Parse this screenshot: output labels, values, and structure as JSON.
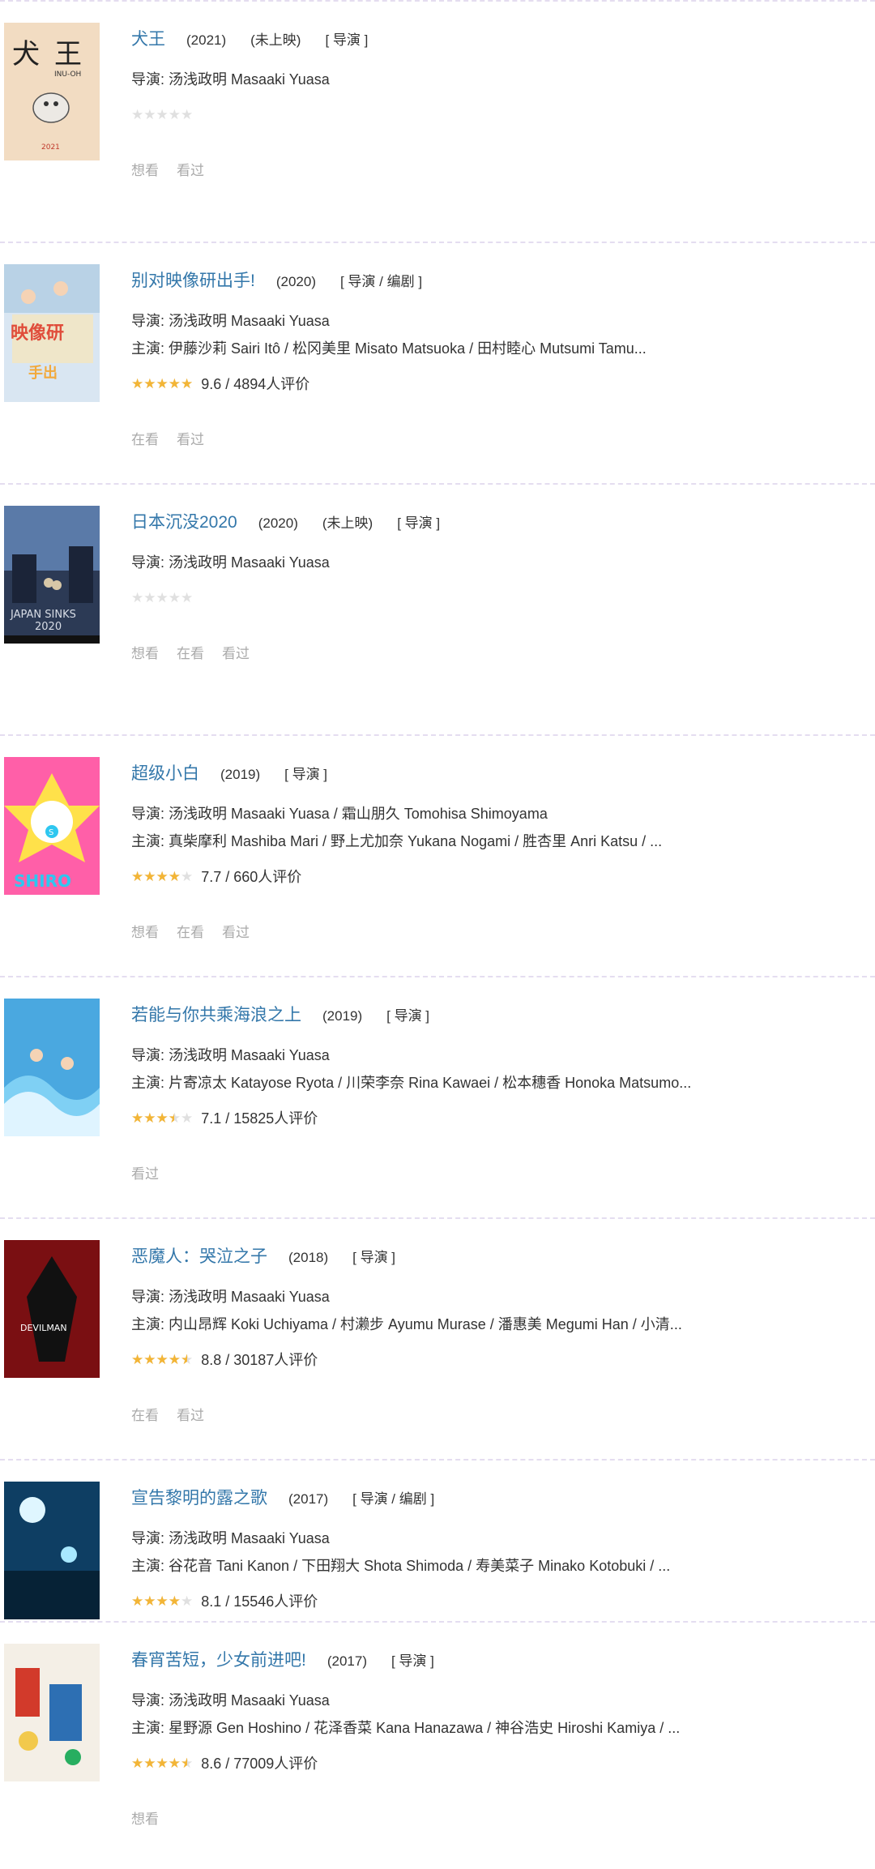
{
  "items": [
    {
      "title": "犬王",
      "meta": [
        "(2021)",
        "(未上映)",
        "[ 导演 ]"
      ],
      "director": "导演: 汤浅政明 Masaaki Yuasa",
      "cast": "",
      "stars": 0,
      "rating": "",
      "actions": [
        "想看",
        "看过"
      ],
      "poster": {
        "bg": "#f2dcc2",
        "accent": "#222",
        "label": "INU-OH"
      }
    },
    {
      "title": "别对映像研出手!",
      "meta": [
        "(2020)",
        "[ 导演 / 编剧 ]"
      ],
      "director": "导演: 汤浅政明 Masaaki Yuasa",
      "cast": "主演: 伊藤沙莉 Sairi Itô / 松冈美里 Misato Matsuoka / 田村睦心 Mutsumi Tamu...",
      "stars": 5,
      "rating": "9.6 / 4894人评价",
      "actions": [
        "在看",
        "看过"
      ],
      "poster": {
        "bg": "#d9e6f2",
        "accent": "#e04d3b",
        "label": ""
      }
    },
    {
      "title": "日本沉没2020",
      "meta": [
        "(2020)",
        "(未上映)",
        "[ 导演 ]"
      ],
      "director": "导演: 汤浅政明 Masaaki Yuasa",
      "cast": "",
      "stars": 0,
      "rating": "",
      "actions": [
        "想看",
        "在看",
        "看过"
      ],
      "poster": {
        "bg": "#2c3a55",
        "accent": "#d8dde6",
        "label": "JAPAN SINKS"
      }
    },
    {
      "title": "超级小白",
      "meta": [
        "(2019)",
        "[ 导演 ]"
      ],
      "director": "导演: 汤浅政明 Masaaki Yuasa / 霜山朋久 Tomohisa Shimoyama",
      "cast": "主演: 真柴摩利 Mashiba Mari / 野上尤加奈 Yukana Nogami / 胜杏里 Anri Katsu / ...",
      "stars": 4,
      "rating": "7.7 / 660人评价",
      "actions": [
        "想看",
        "在看",
        "看过"
      ],
      "poster": {
        "bg": "#ff5fa8",
        "accent": "#2ec7f0",
        "label": "SHIRO"
      }
    },
    {
      "title": "若能与你共乘海浪之上",
      "meta": [
        "(2019)",
        "[ 导演 ]"
      ],
      "director": "导演: 汤浅政明 Masaaki Yuasa",
      "cast": "主演: 片寄凉太 Katayose Ryota / 川荣李奈 Rina Kawaei / 松本穗香 Honoka Matsumo...",
      "stars": 3.5,
      "rating": "7.1 / 15825人评价",
      "actions": [
        "看过"
      ],
      "poster": {
        "bg": "#4aa8e0",
        "accent": "#ffffff",
        "label": ""
      }
    },
    {
      "title": "恶魔人：哭泣之子",
      "meta": [
        "(2018)",
        "[ 导演 ]"
      ],
      "director": "导演: 汤浅政明 Masaaki Yuasa",
      "cast": "主演: 内山昂辉 Koki Uchiyama / 村濑步 Ayumu Murase / 潘惠美 Megumi Han / 小清...",
      "stars": 4.5,
      "rating": "8.8 / 30187人评价",
      "actions": [
        "在看",
        "看过"
      ],
      "poster": {
        "bg": "#7a0f12",
        "accent": "#111111",
        "label": "DEVILMAN"
      }
    },
    {
      "title": "宣告黎明的露之歌",
      "meta": [
        "(2017)",
        "[ 导演 / 编剧 ]"
      ],
      "director": "导演: 汤浅政明 Masaaki Yuasa",
      "cast": "主演: 谷花音 Tani Kanon / 下田翔大 Shota Shimoda / 寿美菜子 Minako Kotobuki / ...",
      "stars": 4,
      "rating": "8.1 / 15546人评价",
      "actions": [],
      "poster": {
        "bg": "#0e3e63",
        "accent": "#a8e8ff",
        "label": ""
      }
    },
    {
      "title": "春宵苦短，少女前进吧!",
      "meta": [
        "(2017)",
        "[ 导演 ]"
      ],
      "director": "导演: 汤浅政明 Masaaki Yuasa",
      "cast": "主演: 星野源 Gen Hoshino / 花泽香菜 Kana Hanazawa / 神谷浩史 Hiroshi Kamiya / ...",
      "stars": 4.5,
      "rating": "8.6 / 77009人评价",
      "actions": [
        "想看"
      ],
      "poster": {
        "bg": "#f4efe6",
        "accent": "#d23a2b",
        "label": ""
      }
    }
  ],
  "icons": {
    "star": "star-icon"
  },
  "colors": {
    "title": "#3377aa",
    "star": "#f3b536",
    "star_empty": "#e0e0e0",
    "action": "#aaaaaa"
  }
}
